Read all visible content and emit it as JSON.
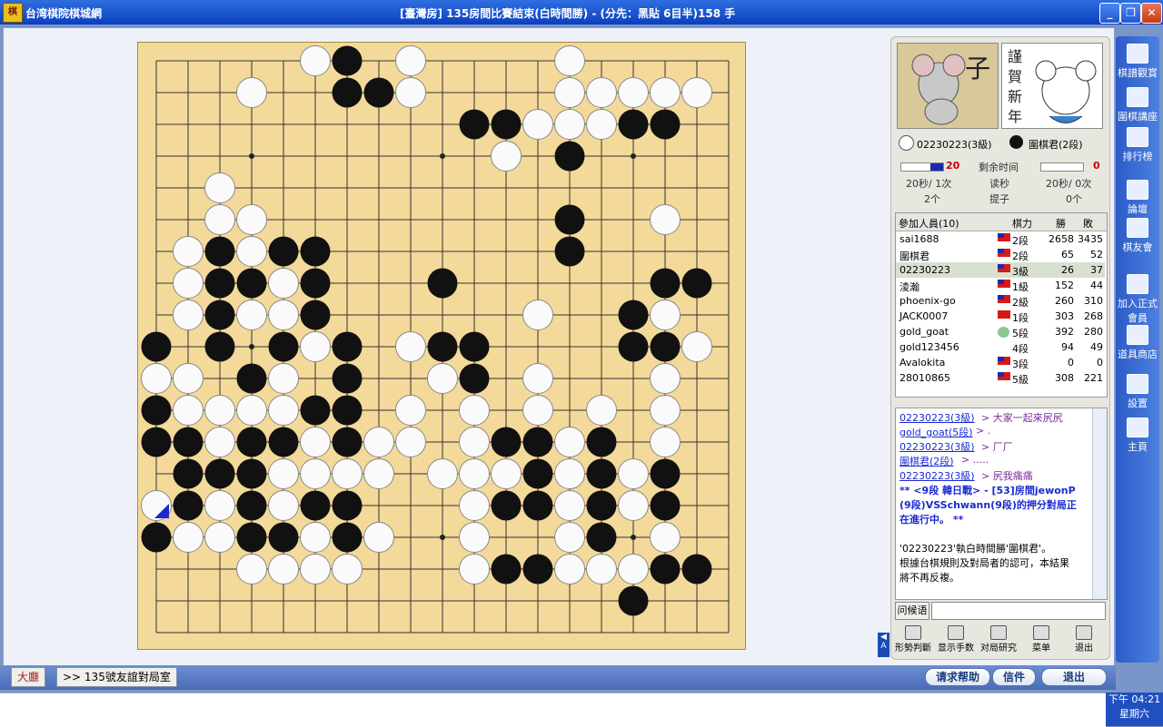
{
  "window": {
    "app_name": "台湾棋院棋城網",
    "title": "[臺灣房] 135房間比賽結束(白時間勝) - (分先：黑貼 6目半)158 手",
    "min": "_",
    "max": "❐",
    "close": "✕"
  },
  "board": {
    "size": 19,
    "black": [
      [
        6,
        0
      ],
      [
        6,
        1
      ],
      [
        7,
        1
      ],
      [
        10,
        2
      ],
      [
        11,
        2
      ],
      [
        14,
        2
      ],
      [
        15,
        2
      ],
      [
        16,
        2
      ],
      [
        13,
        3
      ],
      [
        13,
        5
      ],
      [
        13,
        6
      ],
      [
        2,
        6
      ],
      [
        4,
        6
      ],
      [
        5,
        6
      ],
      [
        2,
        7
      ],
      [
        3,
        7
      ],
      [
        5,
        7
      ],
      [
        16,
        7
      ],
      [
        17,
        7
      ],
      [
        9,
        7
      ],
      [
        1,
        8
      ],
      [
        2,
        8
      ],
      [
        5,
        8
      ],
      [
        15,
        8
      ],
      [
        0,
        9
      ],
      [
        2,
        9
      ],
      [
        4,
        9
      ],
      [
        6,
        9
      ],
      [
        9,
        9
      ],
      [
        10,
        9
      ],
      [
        15,
        9
      ],
      [
        16,
        9
      ],
      [
        3,
        10
      ],
      [
        6,
        10
      ],
      [
        10,
        10
      ],
      [
        0,
        11
      ],
      [
        5,
        11
      ],
      [
        6,
        11
      ],
      [
        0,
        12
      ],
      [
        1,
        12
      ],
      [
        3,
        12
      ],
      [
        4,
        12
      ],
      [
        6,
        12
      ],
      [
        11,
        12
      ],
      [
        12,
        12
      ],
      [
        14,
        12
      ],
      [
        1,
        13
      ],
      [
        2,
        13
      ],
      [
        3,
        13
      ],
      [
        12,
        13
      ],
      [
        14,
        13
      ],
      [
        16,
        13
      ],
      [
        1,
        14
      ],
      [
        3,
        14
      ],
      [
        5,
        14
      ],
      [
        6,
        14
      ],
      [
        11,
        14
      ],
      [
        12,
        14
      ],
      [
        14,
        14
      ],
      [
        16,
        14
      ],
      [
        0,
        15
      ],
      [
        3,
        15
      ],
      [
        4,
        15
      ],
      [
        6,
        15
      ],
      [
        14,
        15
      ],
      [
        11,
        16
      ],
      [
        12,
        16
      ],
      [
        16,
        16
      ],
      [
        17,
        16
      ],
      [
        15,
        17
      ]
    ],
    "white": [
      [
        5,
        0
      ],
      [
        8,
        0
      ],
      [
        13,
        0
      ],
      [
        3,
        1
      ],
      [
        8,
        1
      ],
      [
        13,
        1
      ],
      [
        14,
        1
      ],
      [
        15,
        1
      ],
      [
        16,
        1
      ],
      [
        17,
        1
      ],
      [
        12,
        2
      ],
      [
        13,
        2
      ],
      [
        14,
        2
      ],
      [
        11,
        3
      ],
      [
        2,
        4
      ],
      [
        2,
        5
      ],
      [
        3,
        5
      ],
      [
        16,
        5
      ],
      [
        1,
        6
      ],
      [
        3,
        6
      ],
      [
        1,
        7
      ],
      [
        4,
        7
      ],
      [
        1,
        8
      ],
      [
        3,
        8
      ],
      [
        4,
        8
      ],
      [
        12,
        8
      ],
      [
        16,
        8
      ],
      [
        5,
        9
      ],
      [
        8,
        9
      ],
      [
        17,
        9
      ],
      [
        0,
        10
      ],
      [
        1,
        10
      ],
      [
        4,
        10
      ],
      [
        9,
        10
      ],
      [
        12,
        10
      ],
      [
        16,
        10
      ],
      [
        1,
        11
      ],
      [
        2,
        11
      ],
      [
        3,
        11
      ],
      [
        4,
        11
      ],
      [
        8,
        11
      ],
      [
        10,
        11
      ],
      [
        12,
        11
      ],
      [
        14,
        11
      ],
      [
        16,
        11
      ],
      [
        2,
        12
      ],
      [
        5,
        12
      ],
      [
        7,
        12
      ],
      [
        8,
        12
      ],
      [
        10,
        12
      ],
      [
        13,
        12
      ],
      [
        16,
        12
      ],
      [
        4,
        13
      ],
      [
        5,
        13
      ],
      [
        6,
        13
      ],
      [
        7,
        13
      ],
      [
        9,
        13
      ],
      [
        10,
        13
      ],
      [
        11,
        13
      ],
      [
        13,
        13
      ],
      [
        15,
        13
      ],
      [
        0,
        14
      ],
      [
        2,
        14
      ],
      [
        4,
        14
      ],
      [
        10,
        14
      ],
      [
        13,
        14
      ],
      [
        15,
        14
      ],
      [
        1,
        15
      ],
      [
        2,
        15
      ],
      [
        5,
        15
      ],
      [
        7,
        15
      ],
      [
        10,
        15
      ],
      [
        13,
        15
      ],
      [
        16,
        15
      ],
      [
        3,
        16
      ],
      [
        4,
        16
      ],
      [
        5,
        16
      ],
      [
        6,
        16
      ],
      [
        10,
        16
      ],
      [
        13,
        16
      ],
      [
        14,
        16
      ],
      [
        15,
        16
      ]
    ],
    "last_move": [
      0,
      14
    ]
  },
  "players": {
    "white_name": "02230223(3級)",
    "black_name": "圍棋君(2段)",
    "avatar_left_char": "子",
    "avatar_right_text": "謹賀新年"
  },
  "timer": {
    "white_remaining": "20",
    "black_remaining": "0",
    "label_remaining": "剩余时间",
    "label_byoyomi": "读秒",
    "label_captures": "提子",
    "white_byoyomi": "20秒/ 1次",
    "black_byoyomi": "20秒/ 0次",
    "white_captures": "2个",
    "black_captures": "0个",
    "white_fill": 0.3,
    "black_fill": 0.0
  },
  "participants": {
    "header_name": "參加人員(10)",
    "header_rank": "棋力",
    "header_win": "勝",
    "header_loss": "敗",
    "rows": [
      {
        "name": "sai1688",
        "rank": "2段",
        "win": "2658",
        "loss": "3435",
        "flag": "tw"
      },
      {
        "name": "圍棋君",
        "rank": "2段",
        "win": "65",
        "loss": "52",
        "flag": "tw"
      },
      {
        "name": "02230223",
        "rank": "3級",
        "win": "26",
        "loss": "37",
        "flag": "tw"
      },
      {
        "name": "淩瀚",
        "rank": "1級",
        "win": "152",
        "loss": "44",
        "flag": "tw"
      },
      {
        "name": "phoenix-go",
        "rank": "2級",
        "win": "260",
        "loss": "310",
        "flag": "tw"
      },
      {
        "name": "JACK0007",
        "rank": "1段",
        "win": "303",
        "loss": "268",
        "flag": "cn"
      },
      {
        "name": "gold_goat",
        "rank": "5段",
        "win": "392",
        "loss": "280",
        "flag": "emo"
      },
      {
        "name": "gold123456",
        "rank": "4段",
        "win": "94",
        "loss": "49",
        "flag": "none"
      },
      {
        "name": "Avalokita",
        "rank": "3段",
        "win": "0",
        "loss": "0",
        "flag": "tw"
      },
      {
        "name": "28010865",
        "rank": "5級",
        "win": "308",
        "loss": "221",
        "flag": "tw"
      }
    ]
  },
  "chat": {
    "lines": [
      {
        "user": "02230223(3級)",
        "msg": "> 大家一起來尻尻"
      },
      {
        "user": "gold_goat(5段)",
        "msg": "> ."
      },
      {
        "user": "02230223(3級)",
        "msg": "> 厂厂"
      },
      {
        "user": "圍棋君(2段)",
        "msg": "> ....."
      },
      {
        "user": "02230223(3級)",
        "msg": "> 尻我痛痛"
      }
    ],
    "notice_1": "** <9段 韓日戰> - [53]房間jewonP",
    "notice_2": "(9段)VSSchwann(9段)的押分對局正",
    "notice_3": "在進行中。 **",
    "result_1": "'02230223'執白時間勝'圍棋君'。",
    "result_2": "根據台棋規則及對局者的認可，本結果",
    "result_3": "將不再反複。",
    "ask_button": "问候语",
    "input_value": ""
  },
  "tools": [
    {
      "label": "形勢判斷",
      "icon": "judge-icon"
    },
    {
      "label": "显示手数",
      "icon": "move-number-icon"
    },
    {
      "label": "对局研究",
      "icon": "study-icon"
    },
    {
      "label": "菜单",
      "icon": "menu-icon"
    },
    {
      "label": "退出",
      "icon": "exit-icon"
    }
  ],
  "rightbar": [
    {
      "label": "棋譜觀賞",
      "icon": "board-icon"
    },
    {
      "label": "圍棋講座",
      "icon": "tv-icon"
    },
    {
      "label": "排行榜",
      "icon": "ranking-icon"
    },
    {
      "label": "論壇",
      "icon": "forum-icon"
    },
    {
      "label": "棋友會",
      "icon": "club-icon"
    },
    {
      "label": "加入正式會員",
      "icon": "join-icon"
    },
    {
      "label": "道具商店",
      "icon": "shop-icon"
    },
    {
      "label": "設置",
      "icon": "settings-icon"
    },
    {
      "label": "主頁",
      "icon": "home-icon"
    }
  ],
  "bottom": {
    "tab_lobby": "大廳",
    "tab_room": ">> 135號友誼對局室",
    "help_button": "请求帮助",
    "mail_button": "信件",
    "exit_button": "退出"
  },
  "clock": {
    "time": "下午 04:21",
    "day": "星期六"
  }
}
